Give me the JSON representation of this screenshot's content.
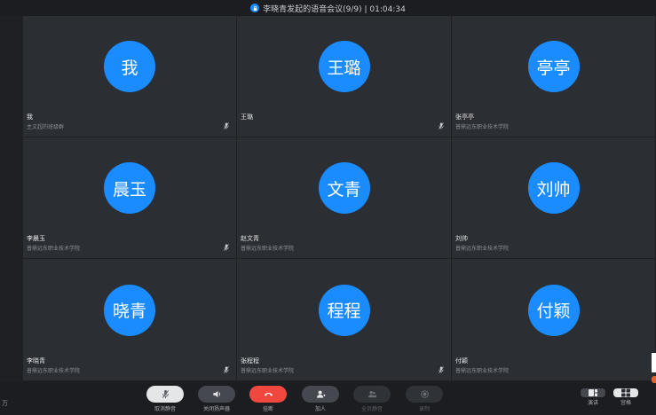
{
  "titlebar": {
    "text": "李晓青发起的语音会议(9/9) | 01:04:34"
  },
  "participants": [
    {
      "avatar": "我",
      "name": "我",
      "org": "主文超的班级群",
      "mic": "muted"
    },
    {
      "avatar": "王璐",
      "name": "王璐",
      "org": "",
      "mic": "muted"
    },
    {
      "avatar": "亭亭",
      "name": "张亭亭",
      "org": "普鼎远东职业技术学院",
      "mic": "none"
    },
    {
      "avatar": "晨玉",
      "name": "李晨玉",
      "org": "普鼎远东职业技术学院",
      "mic": "muted"
    },
    {
      "avatar": "文青",
      "name": "赵文青",
      "org": "普鼎远东职业技术学院",
      "mic": "none"
    },
    {
      "avatar": "刘帅",
      "name": "刘帅",
      "org": "普鼎远东职业技术学院",
      "mic": "none"
    },
    {
      "avatar": "晓青",
      "name": "李晓青",
      "org": "普鼎远东职业技术学院",
      "mic": "muted"
    },
    {
      "avatar": "程程",
      "name": "张程程",
      "org": "普鼎远东职业技术学院",
      "mic": "muted"
    },
    {
      "avatar": "付颖",
      "name": "付颖",
      "org": "普鼎远东职业技术学院",
      "mic": "none"
    }
  ],
  "toolbar": {
    "mute_label": "取消静音",
    "speaker_label": "关闭扬声器",
    "hangup_label": "挂断",
    "add_label": "加人",
    "mute_all_label": "全员静音",
    "record_label": "录制",
    "speaker_view_label": "演讲",
    "grid_view_label": "宫格"
  },
  "corner_mark": "万",
  "colors": {
    "accent": "#1a8cff",
    "hangup": "#f0483e",
    "tile_bg": "#2b2e33",
    "window_bg": "#1e2024"
  }
}
